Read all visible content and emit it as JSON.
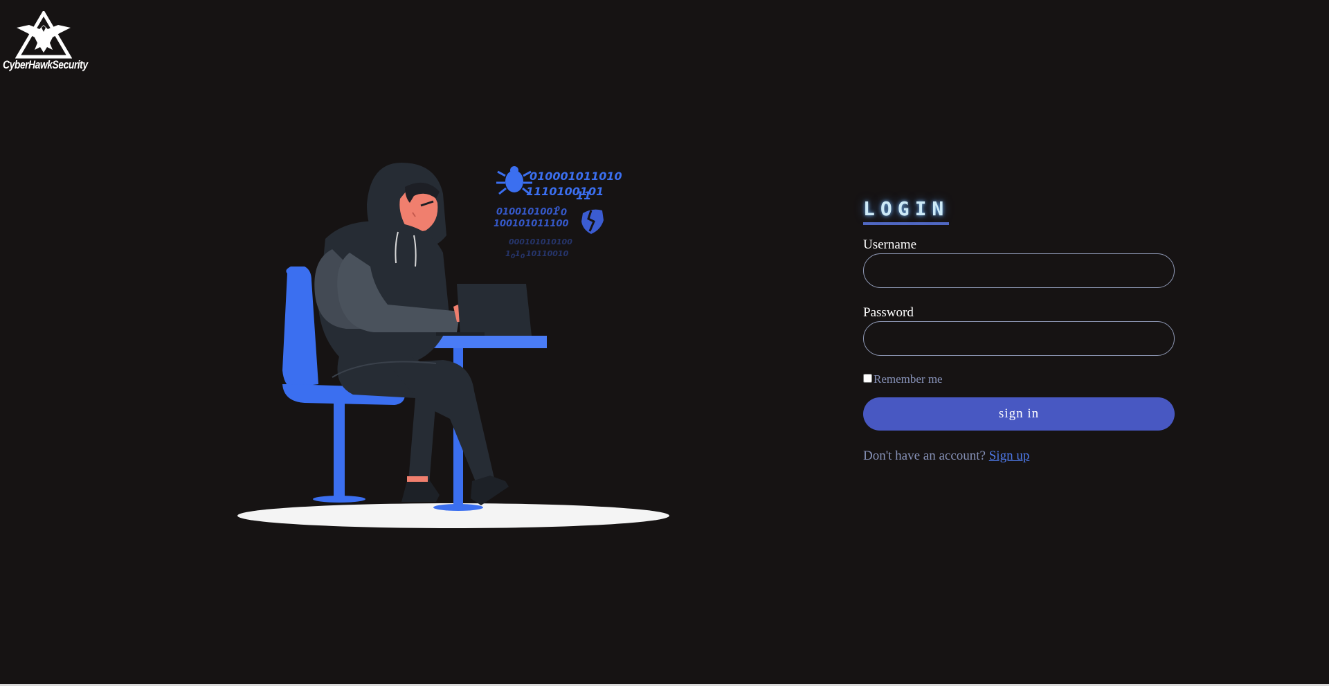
{
  "brand": {
    "name": "CyberHawkSecurity"
  },
  "illustration": {
    "binary_lines": [
      "010001011010",
      "11101001",
      "11",
      "01",
      "0100101001",
      "0",
      "0",
      "100101011100",
      "000101010100",
      "1",
      "0",
      "1",
      "0",
      "10110010"
    ]
  },
  "login": {
    "title": "LOGIN",
    "username_label": "Username",
    "username_value": "",
    "password_label": "Password",
    "password_value": "",
    "remember_label": "Remember me",
    "remember_checked": false,
    "submit_label": "sign in",
    "signup_prompt": "Don't have an account?",
    "signup_link": "Sign up"
  },
  "colors": {
    "background": "#161313",
    "accent": "#4858c2",
    "chair_blue": "#3b6ff0",
    "muted_text": "#8792b8"
  },
  "icons": [
    "hawk-logo-icon",
    "bug-icon",
    "broken-shield-icon"
  ]
}
